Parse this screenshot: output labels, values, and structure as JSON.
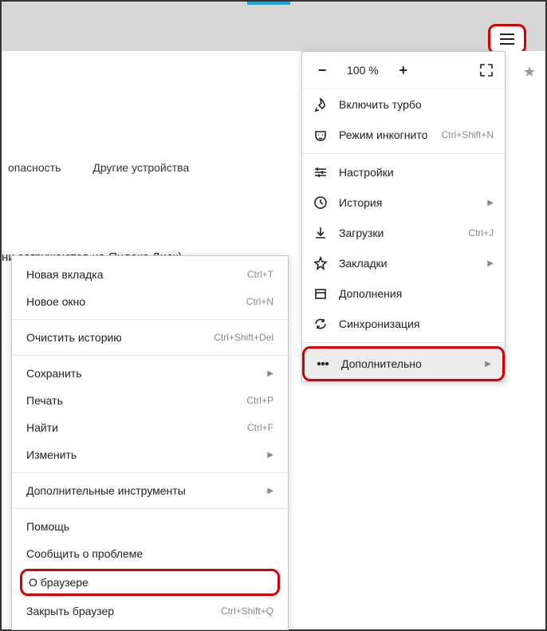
{
  "zoom": {
    "minus": "−",
    "value": "100 %",
    "plus": "+"
  },
  "bg": {
    "tab1": "опасность",
    "tab2": "Другие устройства",
    "note": "ни загружаются на Яндекс.Диск)"
  },
  "menu": {
    "turbo": "Включить турбо",
    "incognito": "Режим инкогнито",
    "incognito_sc": "Ctrl+Shift+N",
    "settings": "Настройки",
    "history": "История",
    "downloads": "Загрузки",
    "downloads_sc": "Ctrl+J",
    "bookmarks": "Закладки",
    "addons": "Дополнения",
    "sync": "Синхронизация",
    "more": "Дополнительно"
  },
  "submenu": {
    "new_tab": "Новая вкладка",
    "new_tab_sc": "Ctrl+T",
    "new_window": "Новое окно",
    "new_window_sc": "Ctrl+N",
    "clear_history": "Очистить историю",
    "clear_history_sc": "Ctrl+Shift+Del",
    "save": "Сохранить",
    "print": "Печать",
    "print_sc": "Ctrl+P",
    "find": "Найти",
    "find_sc": "Ctrl+F",
    "edit": "Изменить",
    "devtools": "Дополнительные инструменты",
    "help": "Помощь",
    "report": "Сообщить о проблеме",
    "about": "О браузере",
    "quit": "Закрыть браузер",
    "quit_sc": "Ctrl+Shift+Q"
  }
}
